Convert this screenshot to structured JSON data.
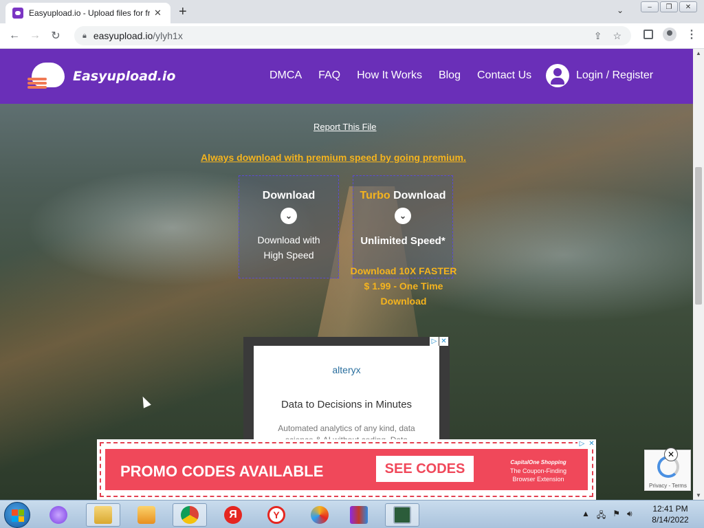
{
  "browser": {
    "tab_title": "Easyupload.io - Upload files for fr",
    "tab_close": "✕",
    "new_tab": "+",
    "url_host": "easyupload.io",
    "url_path": "/ylyh1x"
  },
  "site": {
    "logo_text": "Easyupload.io",
    "nav": [
      "DMCA",
      "FAQ",
      "How It Works",
      "Blog",
      "Contact Us"
    ],
    "login_label": "Login / Register",
    "brand_color": "#6a2fb8"
  },
  "main": {
    "report_link": "Report This File",
    "premium_link": "Always download with premium speed by going premium.",
    "download": {
      "title": "Download",
      "subtitle_line1": "Download with",
      "subtitle_line2": "High Speed"
    },
    "turbo": {
      "title_accent": "Turbo",
      "title_rest": " Download",
      "subtitle": "Unlimited Speed*",
      "note_line1": "Download 10X FASTER",
      "note_line2": "$ 1.99 - One Time",
      "note_line3": "Download"
    },
    "accent_color": "#f5b41e"
  },
  "ads": {
    "box_ad": {
      "brand": "alteryx",
      "headline": "Data to Decisions in Minutes",
      "body": "Automated analytics of any kind, data science & AI without coding. Data"
    },
    "banner_ad": {
      "headline": "PROMO CODES AVAILABLE",
      "cta": "SEE CODES",
      "sponsor_logo": "CapitalOne Shopping",
      "sponsor_line1": "The Coupon-Finding",
      "sponsor_line2": "Browser Extension"
    }
  },
  "recaptcha": {
    "footer": "Privacy - Terms"
  },
  "taskbar": {
    "time": "12:41 PM",
    "date": "8/14/2022"
  }
}
